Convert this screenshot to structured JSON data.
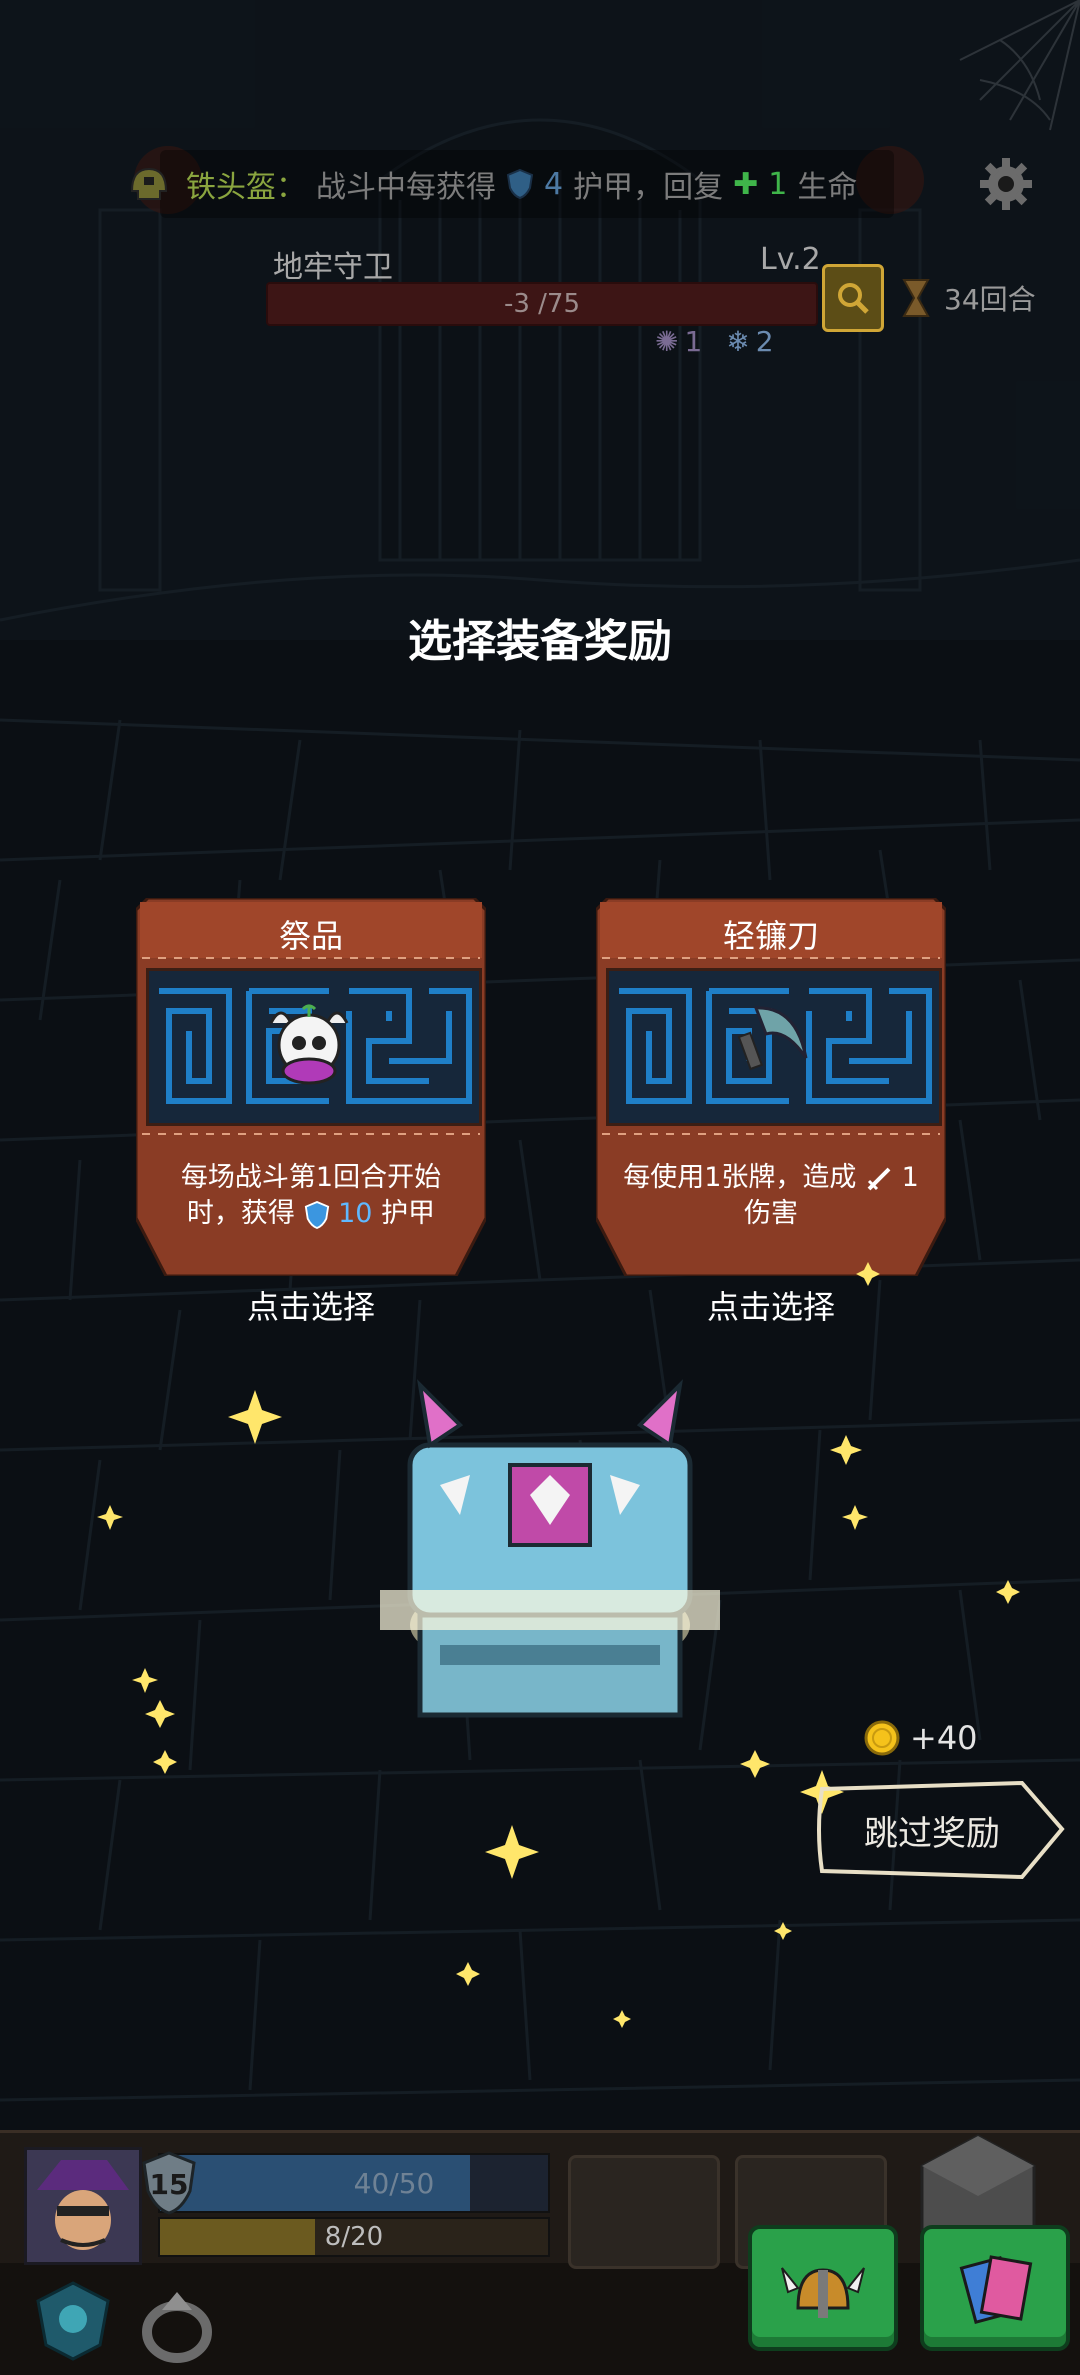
{
  "header": {
    "tip_title": "铁头盔：",
    "tip_prefix": "战斗中每获得",
    "tip_shield_value": "4",
    "tip_mid": "护甲，回复",
    "tip_plus": "✚",
    "tip_heal_value": "1",
    "tip_suffix": "生命",
    "enemy_name": "地牢守卫",
    "enemy_level": "Lv.2",
    "enemy_hp": "-3 /75",
    "enemy_status_1": "1",
    "enemy_status_2": "2",
    "rounds": "34回合"
  },
  "main": {
    "title": "选择装备奖励",
    "cards": [
      {
        "name": "祭品",
        "desc_line1": "每场战斗第1回合开始",
        "desc_line2_prefix": "时，获得",
        "desc_value": "10",
        "desc_line2_suffix": "护甲",
        "select_label": "点击选择"
      },
      {
        "name": "轻镰刀",
        "desc_line1_prefix": "每使用1张牌，造成",
        "desc_value": "1",
        "desc_line2": "伤害",
        "select_label": "点击选择"
      }
    ],
    "coin_reward": "+40",
    "skip_label": "跳过奖励"
  },
  "hud": {
    "level": "15",
    "hp": "40/50",
    "hp_fraction": 0.8,
    "energy": "8/20",
    "energy_fraction": 0.4
  },
  "colors": {
    "card_bg": "#8a3c25",
    "card_header": "#a0462a",
    "maze": "#1f7fc7",
    "green_button": "#2aa14a"
  },
  "icons": [
    "gear-icon",
    "magnifier-icon",
    "hourglass-icon",
    "helmet-icon",
    "cards-icon",
    "shield-icon",
    "sword-icon",
    "coin-icon"
  ]
}
